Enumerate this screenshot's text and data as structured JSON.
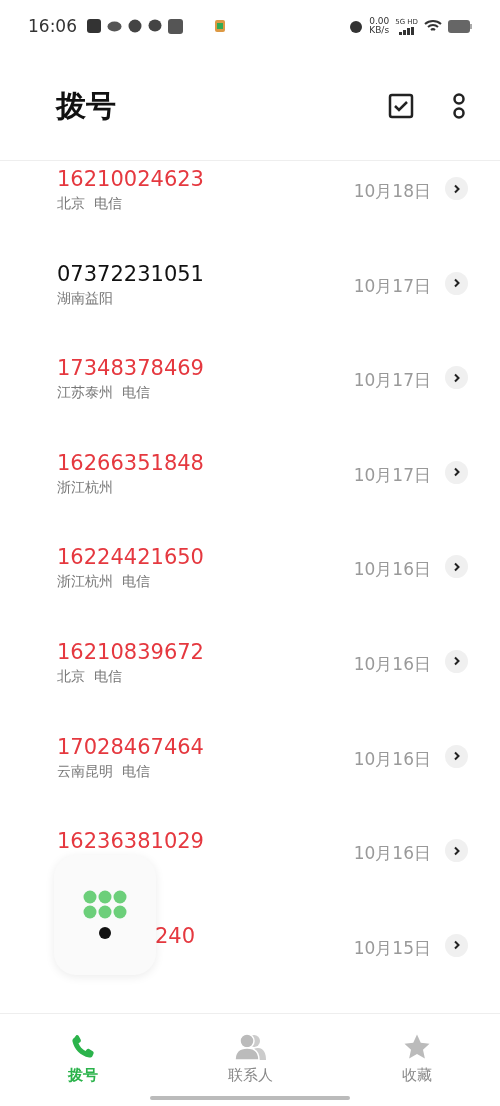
{
  "status_bar": {
    "time": "16:06",
    "speed": "0.00",
    "speed_unit": "KB/s",
    "network": "5G HD"
  },
  "header": {
    "title": "拨号"
  },
  "calls": [
    {
      "number": "16210024623",
      "location": "北京  电信",
      "date": "10月18日",
      "missed": true
    },
    {
      "number": "07372231051",
      "location": "湖南益阳",
      "date": "10月17日",
      "missed": false
    },
    {
      "number": "17348378469",
      "location": "江苏泰州  电信",
      "date": "10月17日",
      "missed": true
    },
    {
      "number": "16266351848",
      "location": "浙江杭州",
      "date": "10月17日",
      "missed": true
    },
    {
      "number": "16224421650",
      "location": "浙江杭州  电信",
      "date": "10月16日",
      "missed": true
    },
    {
      "number": "16210839672",
      "location": "北京  电信",
      "date": "10月16日",
      "missed": true
    },
    {
      "number": "17028467464",
      "location": "云南昆明  电信",
      "date": "10月16日",
      "missed": true
    },
    {
      "number": "16236381029",
      "date": "10月16日",
      "missed": true
    },
    {
      "number": "240",
      "date": "10月15日",
      "missed": true,
      "covered": true
    }
  ],
  "bottom_nav": [
    {
      "label": "拨号",
      "selected": true
    },
    {
      "label": "联系人",
      "selected": false
    },
    {
      "label": "收藏",
      "selected": false
    }
  ]
}
